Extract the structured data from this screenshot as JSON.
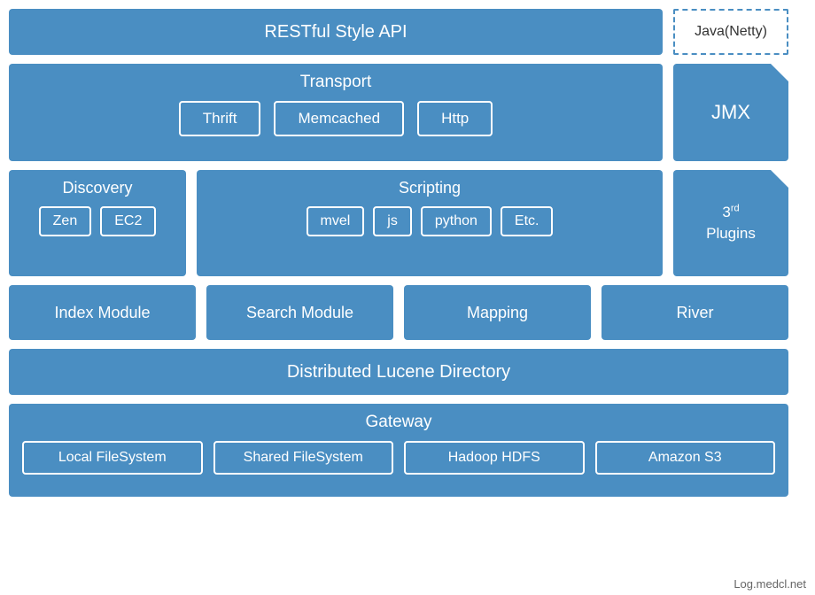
{
  "diagram": {
    "row1": {
      "restful": "RESTful Style API",
      "java_netty": "Java(Netty)"
    },
    "row2": {
      "transport_title": "Transport",
      "transport_items": [
        "Thrift",
        "Memcached",
        "Http"
      ],
      "jmx": "JMX"
    },
    "row3": {
      "discovery": {
        "title": "Discovery",
        "items": [
          "Zen",
          "EC2"
        ]
      },
      "scripting": {
        "title": "Scripting",
        "items": [
          "mvel",
          "js",
          "python",
          "Etc."
        ]
      },
      "plugins": {
        "superscript": "rd",
        "number": "3",
        "label": "Plugins"
      }
    },
    "row4": {
      "modules": [
        "Index Module",
        "Search Module",
        "Mapping",
        "River"
      ]
    },
    "row5": {
      "lucene": "Distributed Lucene Directory"
    },
    "row6": {
      "gateway_title": "Gateway",
      "gateway_items": [
        "Local FileSystem",
        "Shared FileSystem",
        "Hadoop HDFS",
        "Amazon S3"
      ]
    }
  },
  "watermark": "Log.medcl.net"
}
